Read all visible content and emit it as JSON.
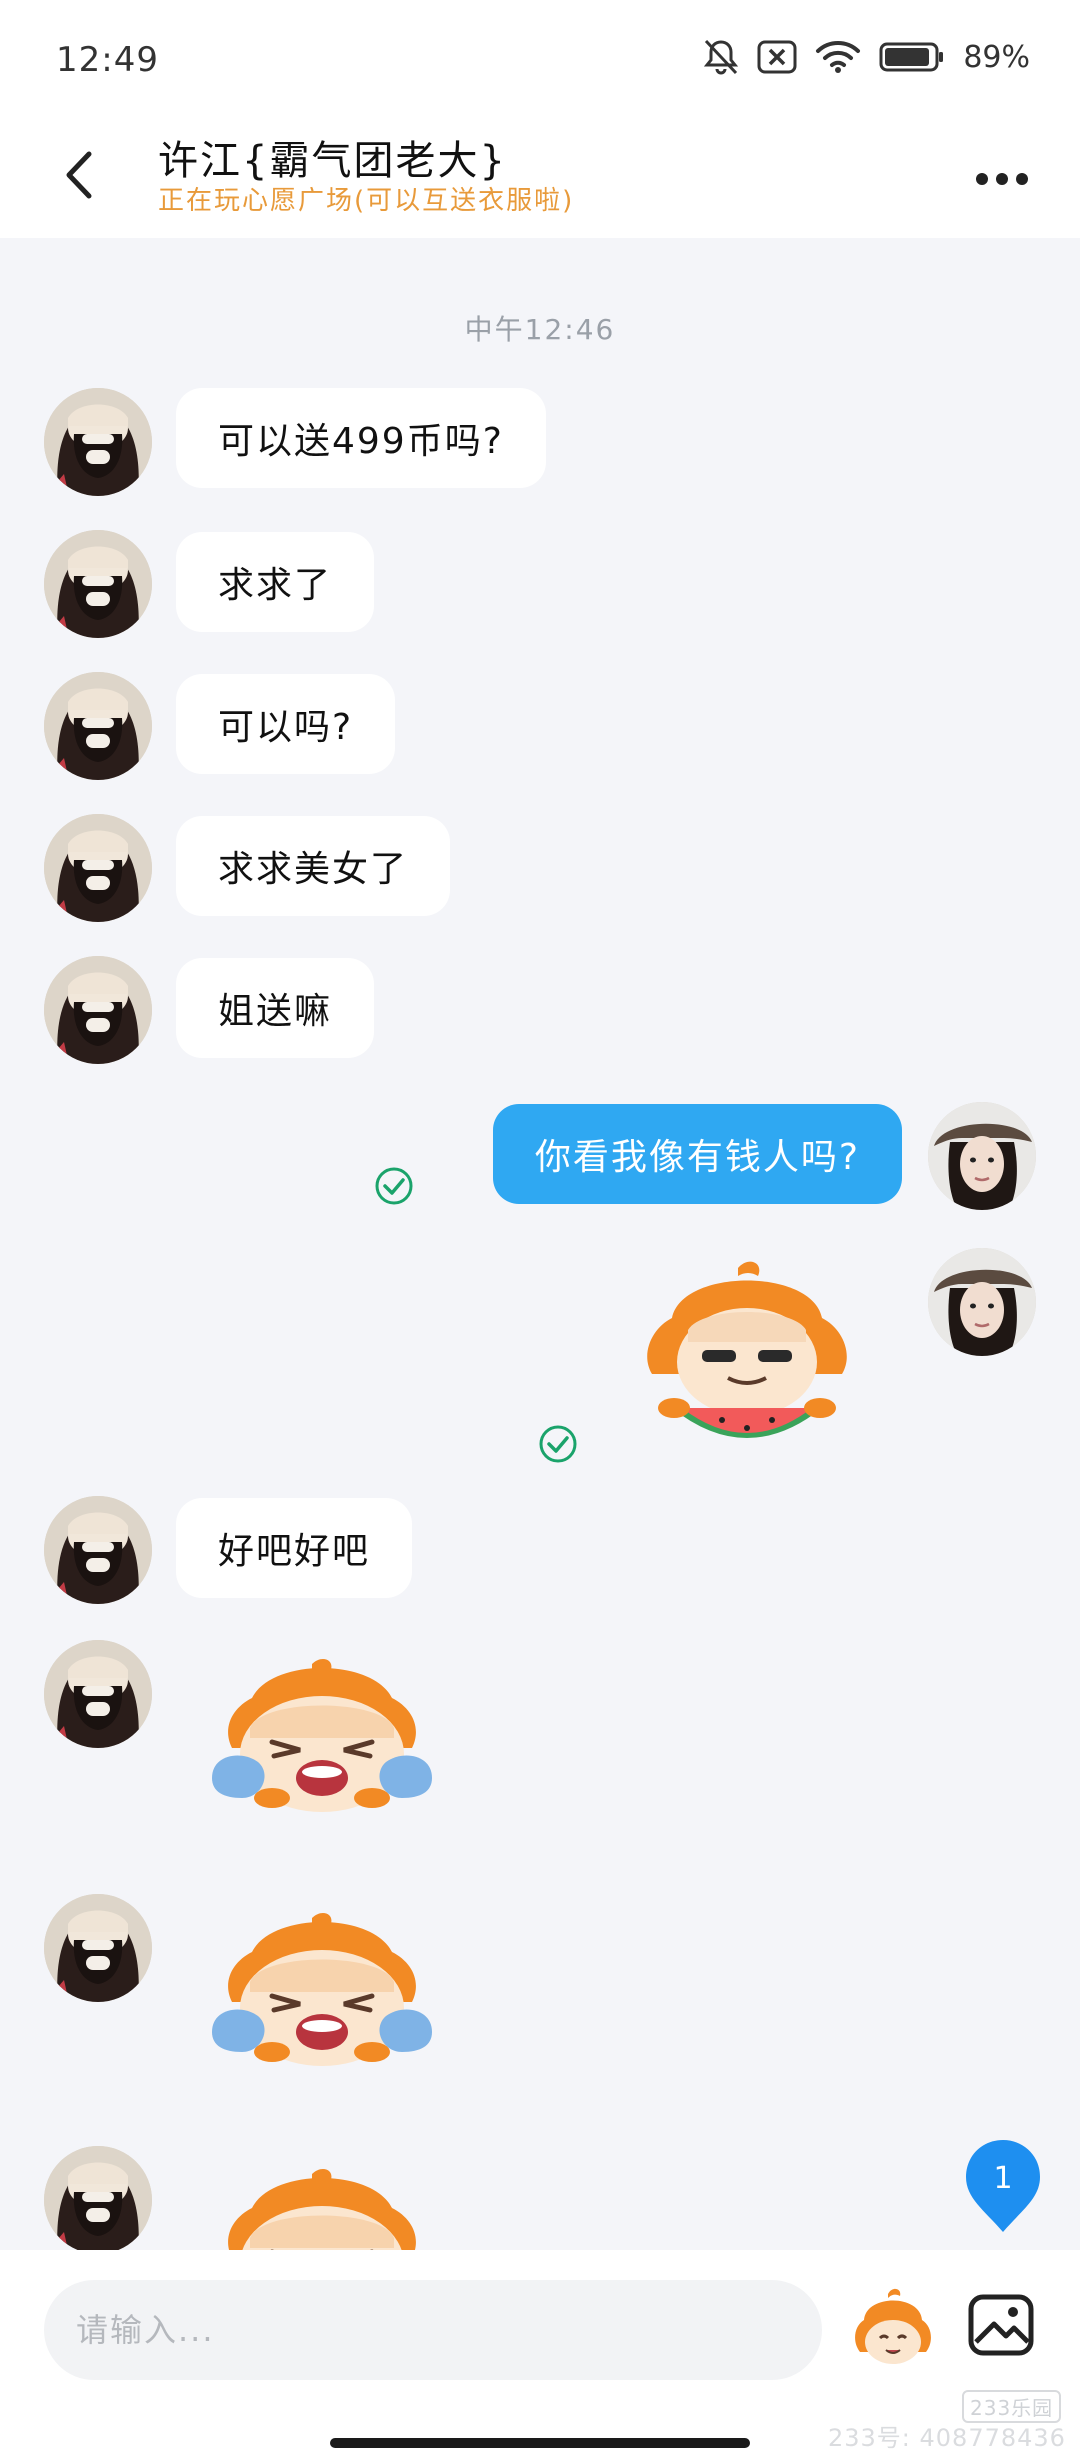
{
  "status_bar": {
    "time": "12:49",
    "battery": "89%",
    "icons": [
      "bell-muted-icon",
      "sim-off-icon",
      "wifi-icon",
      "battery-icon"
    ]
  },
  "header": {
    "title": "许江{霸气团老大}",
    "subtitle": "正在玩心愿广场(可以互送衣服啦)",
    "back_icon": "chevron-left-icon",
    "more_icon": "more-dots-icon"
  },
  "chat": {
    "timestamp": "中午12:46",
    "messages": [
      {
        "side": "incoming",
        "type": "text",
        "text": "可以送499币吗?"
      },
      {
        "side": "incoming",
        "type": "text",
        "text": "求求了"
      },
      {
        "side": "incoming",
        "type": "text",
        "text": "可以吗?"
      },
      {
        "side": "incoming",
        "type": "text",
        "text": "求求美女了"
      },
      {
        "side": "incoming",
        "type": "text",
        "text": "姐送嘛"
      },
      {
        "side": "outgoing",
        "type": "text",
        "text": "你看我像有钱人吗?",
        "read": true
      },
      {
        "side": "outgoing",
        "type": "sticker",
        "sticker": "mascot-eating-watermelon",
        "read": true
      },
      {
        "side": "incoming",
        "type": "text",
        "text": "好吧好吧"
      },
      {
        "side": "incoming",
        "type": "sticker",
        "sticker": "mascot-crying"
      },
      {
        "side": "incoming",
        "type": "sticker",
        "sticker": "mascot-crying"
      },
      {
        "side": "incoming",
        "type": "sticker",
        "sticker": "mascot-crying"
      }
    ],
    "unread_badge": "1"
  },
  "input": {
    "placeholder": "请输入...",
    "emoji_icon": "mascot-emoji-icon",
    "image_icon": "image-icon"
  },
  "watermark": {
    "logo": "233乐园",
    "id": "233号: 408778436"
  },
  "colors": {
    "outgoing_bubble": "#2fa8f2",
    "subtitle": "#e89a3a",
    "read_check": "#1aa36b",
    "background": "#f4f5f9"
  }
}
